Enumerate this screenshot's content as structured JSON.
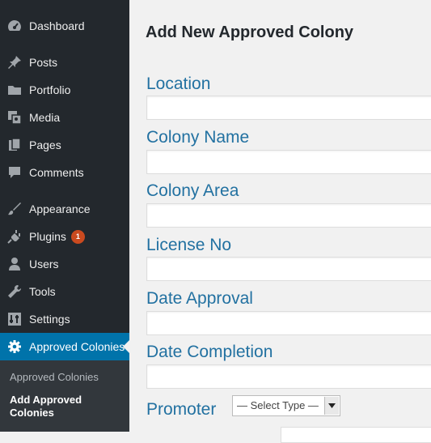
{
  "sidebar": {
    "items": [
      {
        "label": "Dashboard",
        "icon": "dashboard-icon"
      },
      {
        "label": "Posts",
        "icon": "pin-icon"
      },
      {
        "label": "Portfolio",
        "icon": "folder-icon"
      },
      {
        "label": "Media",
        "icon": "media-icon"
      },
      {
        "label": "Pages",
        "icon": "pages-icon"
      },
      {
        "label": "Comments",
        "icon": "comment-icon"
      },
      {
        "label": "Appearance",
        "icon": "brush-icon"
      },
      {
        "label": "Plugins",
        "icon": "plug-icon",
        "badge": "1"
      },
      {
        "label": "Users",
        "icon": "user-icon"
      },
      {
        "label": "Tools",
        "icon": "wrench-icon"
      },
      {
        "label": "Settings",
        "icon": "settings-icon"
      },
      {
        "label": "Approved Colonies",
        "icon": "gear-icon",
        "active": true
      }
    ],
    "submenu": [
      {
        "label": "Approved Colonies"
      },
      {
        "label": "Add Approved Colonies",
        "line1": "Add Approved",
        "line2": "Colonies",
        "current": true
      }
    ]
  },
  "main": {
    "title": "Add New Approved Colony",
    "fields": [
      {
        "label": "Location",
        "value": ""
      },
      {
        "label": "Colony Name",
        "value": ""
      },
      {
        "label": "Colony Area",
        "value": ""
      },
      {
        "label": "License No",
        "value": ""
      },
      {
        "label": "Date Approval",
        "value": ""
      },
      {
        "label": "Date Completion",
        "value": ""
      }
    ],
    "promoter": {
      "label": "Promoter",
      "selected": "— Select Type —"
    }
  },
  "colors": {
    "sidebar_bg": "#23282d",
    "active": "#0073aa",
    "label_blue": "#2271a1",
    "badge": "#ca4a1f"
  }
}
